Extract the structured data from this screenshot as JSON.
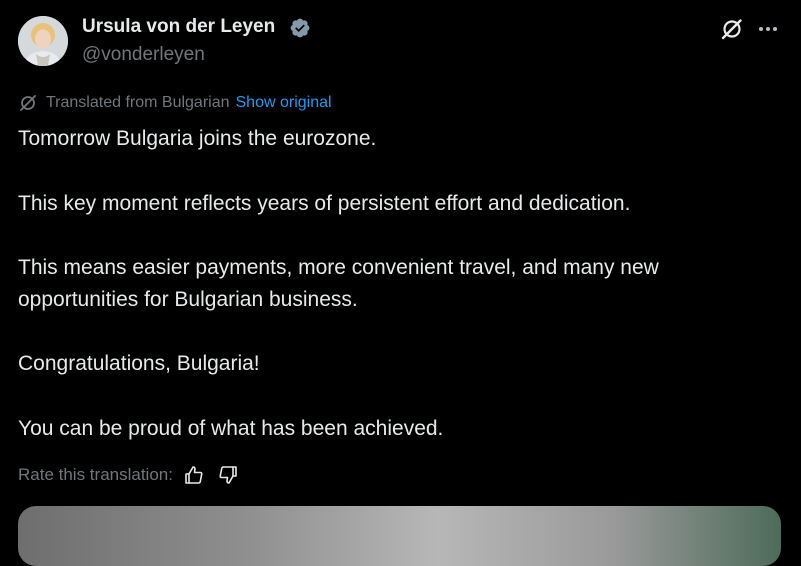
{
  "author": {
    "name": "Ursula von der Leyen",
    "handle": "@vonderleyen",
    "verified": true,
    "avatar_icon": "avatar-portrait"
  },
  "header_actions": {
    "grok_icon": "grok-icon",
    "more_icon": "more-icon"
  },
  "translation": {
    "icon": "grok-translate-icon",
    "label": "Translated from Bulgarian",
    "show_original": "Show original"
  },
  "tweet": {
    "paragraphs": [
      "Tomorrow Bulgaria joins the eurozone.",
      "This key moment reflects years of persistent effort and dedication.",
      "This means easier payments, more convenient travel, and many new opportunities for Bulgarian business.",
      "Congratulations, Bulgaria!",
      "You can be proud of what has been achieved."
    ]
  },
  "rating": {
    "label": "Rate this translation:",
    "thumbs_up_icon": "thumbs-up-icon",
    "thumbs_down_icon": "thumbs-down-icon"
  },
  "colors": {
    "background": "#000000",
    "text": "#e7e9ea",
    "secondary_text": "#71767b",
    "link": "#1d9bf0",
    "verified_badge": "#829aab"
  }
}
